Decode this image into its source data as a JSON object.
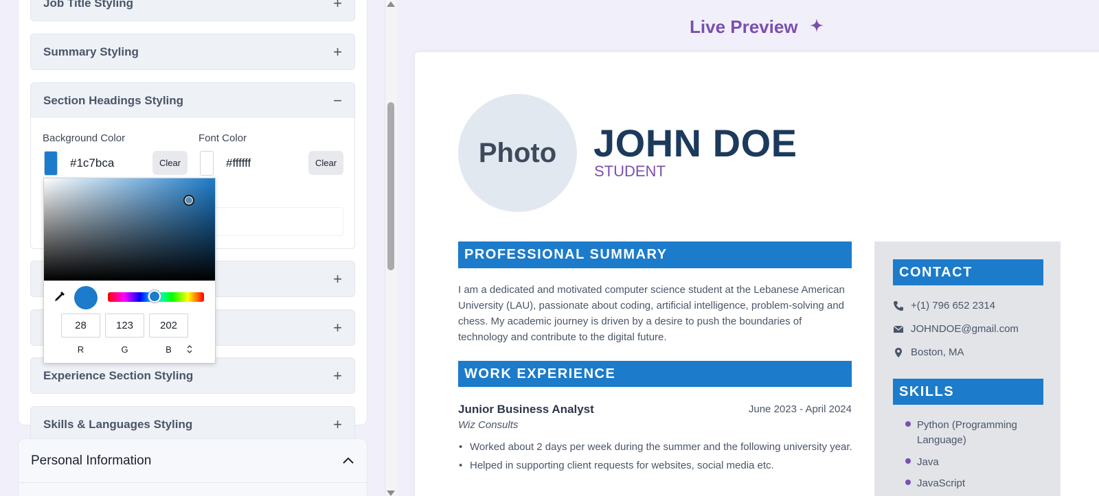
{
  "left_panel": {
    "sections": [
      {
        "title": "Job Title Styling",
        "sign": "+"
      },
      {
        "title": "Summary Styling",
        "sign": "+"
      },
      {
        "title": "Section Headings Styling",
        "sign": "−"
      },
      {
        "title": "",
        "sign": "+"
      },
      {
        "title": "",
        "sign": "+"
      },
      {
        "title": "Experience Section Styling",
        "sign": "+"
      },
      {
        "title": "Skills & Languages Styling",
        "sign": "+"
      }
    ],
    "section_headings": {
      "bg_label": "Background Color",
      "bg_value": "#1c7bca",
      "bg_clear": "Clear",
      "font_label": "Font Color",
      "font_value": "#ffffff",
      "font_clear": "Clear"
    },
    "color_picker": {
      "r": "28",
      "g": "123",
      "b": "202",
      "r_label": "R",
      "g_label": "G",
      "b_label": "B",
      "toggle": "⌃⌄"
    },
    "personal_info_title": "Personal Information"
  },
  "preview": {
    "title": "Live Preview",
    "photo_label": "Photo",
    "name": "JOHN DOE",
    "job_title": "STUDENT",
    "summary_heading": "PROFESSIONAL SUMMARY",
    "summary_text": "I am a dedicated and motivated computer science student at the Lebanese American University (LAU), passionate about coding, artificial intelligence, problem-solving and chess. My academic journey is driven by a desire to push the boundaries of technology and contribute to the digital future.",
    "work_heading": "WORK EXPERIENCE",
    "experience": {
      "title": "Junior Business Analyst",
      "dates": "June 2023 - April 2024",
      "company": "Wiz Consults",
      "bullets": [
        "Worked about 2 days per week during the summer and the following university year.",
        "Helped in supporting client requests for websites, social media etc."
      ]
    },
    "contact_heading": "CONTACT",
    "contact": {
      "phone": "+(1) 796 652 2314",
      "email": "JOHNDOE@gmail.com",
      "location": "Boston, MA"
    },
    "skills_heading": "SKILLS",
    "skills": [
      "Python (Programming Language)",
      "Java",
      "JavaScript"
    ]
  },
  "colors": {
    "heading_bg": "#1c7bca",
    "accent_purple": "#7a4fb0",
    "name_color": "#1b3a5c",
    "sidebar_bg": "#e2e4e8"
  }
}
